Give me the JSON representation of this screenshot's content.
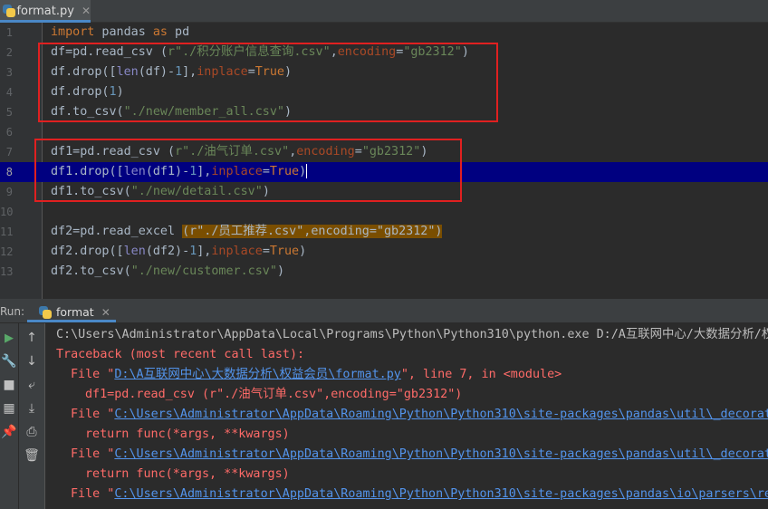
{
  "tab": {
    "title": "format.py",
    "close_glyph": "✕"
  },
  "editor": {
    "lines": [
      {
        "n": "1",
        "segments": [
          {
            "t": "import",
            "c": "kw"
          },
          {
            "t": " pandas ",
            "c": ""
          },
          {
            "t": "as",
            "c": "kw"
          },
          {
            "t": " pd",
            "c": ""
          }
        ]
      },
      {
        "n": "2",
        "segments": [
          {
            "t": "df=pd.read_csv ",
            "c": ""
          },
          {
            "t": "(",
            "c": ""
          },
          {
            "t": "r\"./积分账户信息查询.csv\"",
            "c": "str"
          },
          {
            "t": ",",
            "c": ""
          },
          {
            "t": "encoding",
            "c": "param"
          },
          {
            "t": "=",
            "c": ""
          },
          {
            "t": "\"gb2312\"",
            "c": "str"
          },
          {
            "t": ")",
            "c": ""
          }
        ]
      },
      {
        "n": "3",
        "segments": [
          {
            "t": "df.drop([",
            "c": ""
          },
          {
            "t": "len",
            "c": "bi"
          },
          {
            "t": "(df)-",
            "c": ""
          },
          {
            "t": "1",
            "c": "num"
          },
          {
            "t": "],",
            "c": ""
          },
          {
            "t": "inplace",
            "c": "param"
          },
          {
            "t": "=",
            "c": ""
          },
          {
            "t": "True",
            "c": "kw"
          },
          {
            "t": ")",
            "c": ""
          }
        ]
      },
      {
        "n": "4",
        "segments": [
          {
            "t": "df.drop(",
            "c": ""
          },
          {
            "t": "1",
            "c": "num"
          },
          {
            "t": ")",
            "c": ""
          }
        ]
      },
      {
        "n": "5",
        "segments": [
          {
            "t": "df.to_csv(",
            "c": ""
          },
          {
            "t": "\"./new/member_all.csv\"",
            "c": "str"
          },
          {
            "t": ")",
            "c": ""
          }
        ]
      },
      {
        "n": "6",
        "segments": []
      },
      {
        "n": "7",
        "segments": [
          {
            "t": "df1=pd.read_csv ",
            "c": ""
          },
          {
            "t": "(",
            "c": ""
          },
          {
            "t": "r\"./油气订单.csv\"",
            "c": "str"
          },
          {
            "t": ",",
            "c": ""
          },
          {
            "t": "encoding",
            "c": "param"
          },
          {
            "t": "=",
            "c": ""
          },
          {
            "t": "\"gb2312\"",
            "c": "str"
          },
          {
            "t": ")",
            "c": ""
          }
        ]
      },
      {
        "n": "8",
        "segments": [
          {
            "t": "df1.drop([",
            "c": ""
          },
          {
            "t": "len",
            "c": "bi"
          },
          {
            "t": "(df1)-",
            "c": ""
          },
          {
            "t": "1",
            "c": "num"
          },
          {
            "t": "],",
            "c": ""
          },
          {
            "t": "inplace",
            "c": "param"
          },
          {
            "t": "=",
            "c": ""
          },
          {
            "t": "True",
            "c": "kw"
          },
          {
            "t": ")",
            "c": ""
          }
        ]
      },
      {
        "n": "9",
        "segments": [
          {
            "t": "df1.to_csv(",
            "c": ""
          },
          {
            "t": "\"./new/detail.csv\"",
            "c": "str"
          },
          {
            "t": ")",
            "c": ""
          }
        ]
      },
      {
        "n": "10",
        "segments": []
      },
      {
        "n": "11",
        "segments": [
          {
            "t": "df2=pd.read_excel ",
            "c": ""
          },
          {
            "t": "(r\"./员工推荐.csv\",encoding=\"gb2312\")",
            "c": "hl"
          }
        ]
      },
      {
        "n": "12",
        "segments": [
          {
            "t": "df2.drop([",
            "c": ""
          },
          {
            "t": "len",
            "c": "bi"
          },
          {
            "t": "(df2)-",
            "c": ""
          },
          {
            "t": "1",
            "c": "num"
          },
          {
            "t": "],",
            "c": ""
          },
          {
            "t": "inplace",
            "c": "param"
          },
          {
            "t": "=",
            "c": ""
          },
          {
            "t": "True",
            "c": "kw"
          },
          {
            "t": ")",
            "c": ""
          }
        ]
      },
      {
        "n": "13",
        "segments": [
          {
            "t": "df2.to_csv(",
            "c": ""
          },
          {
            "t": "\"./new/customer.csv\"",
            "c": "str"
          },
          {
            "t": ")",
            "c": ""
          }
        ]
      }
    ],
    "current_line": "8"
  },
  "run": {
    "label": "Run:",
    "tab_title": "format",
    "close_glyph": "✕",
    "toolbar": [
      {
        "name": "rerun-icon",
        "glyph": "▶"
      },
      {
        "name": "wrench-icon",
        "glyph": "🔧"
      },
      {
        "name": "stop-icon",
        "glyph": "■"
      },
      {
        "name": "layout-icon",
        "glyph": "▦"
      },
      {
        "name": "pin-icon",
        "glyph": "📌"
      }
    ],
    "toolbar2": [
      {
        "name": "up-arrow-icon",
        "glyph": "↑"
      },
      {
        "name": "down-arrow-icon",
        "glyph": "↓"
      },
      {
        "name": "soft-wrap-icon",
        "glyph": "⤶"
      },
      {
        "name": "scroll-to-end-icon",
        "glyph": "⤓"
      },
      {
        "name": "print-icon",
        "glyph": "⎙"
      },
      {
        "name": "trash-icon",
        "glyph": "🗑"
      }
    ]
  },
  "console": {
    "command": "C:\\Users\\Administrator\\AppData\\Local\\Programs\\Python\\Python310\\python.exe D:/A互联网中心/大数据分析/权益",
    "traceback_header": "Traceback (most recent call last):",
    "frames": [
      {
        "file": "D:\\A互联网中心\\大数据分析\\权益会员\\format.py",
        "suffix": ", line 7, in <module>",
        "code": "df1=pd.read_csv (r\"./油气订单.csv\",encoding=\"gb2312\")"
      },
      {
        "file": "C:\\Users\\Administrator\\AppData\\Roaming\\Python\\Python310\\site-packages\\pandas\\util\\_decorato",
        "suffix": "",
        "code": "return func(*args, **kwargs)"
      },
      {
        "file": "C:\\Users\\Administrator\\AppData\\Roaming\\Python\\Python310\\site-packages\\pandas\\util\\_decorato",
        "suffix": "",
        "code": "return func(*args, **kwargs)"
      },
      {
        "file": "C:\\Users\\Administrator\\AppData\\Roaming\\Python\\Python310\\site-packages\\pandas\\io\\parsers\\rea",
        "suffix": "",
        "code": ""
      }
    ],
    "file_prefix": "File \"",
    "file_close_quote": "\""
  }
}
